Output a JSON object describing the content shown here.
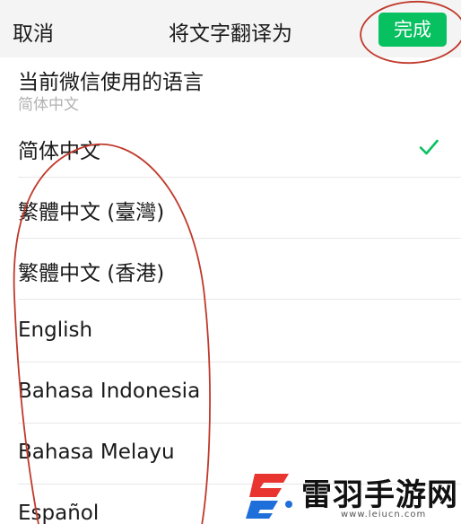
{
  "nav": {
    "cancel_label": "取消",
    "title": "将文字翻译为",
    "done_label": "完成"
  },
  "current_language": {
    "label": "当前微信使用的语言",
    "value": "简体中文"
  },
  "languages": [
    {
      "label": "简体中文",
      "selected": true
    },
    {
      "label": "繁體中文 (臺灣)",
      "selected": false
    },
    {
      "label": "繁體中文 (香港)",
      "selected": false
    },
    {
      "label": "English",
      "selected": false
    },
    {
      "label": "Bahasa Indonesia",
      "selected": false
    },
    {
      "label": "Bahasa Melayu",
      "selected": false
    },
    {
      "label": "Español",
      "selected": false
    }
  ],
  "icons": {
    "selected": "check-icon"
  },
  "colors": {
    "accent": "#07c160",
    "annotation": "#c0392b",
    "watermark_red": "#e8352f",
    "watermark_blue": "#1e6fd9"
  },
  "watermark": {
    "brand": "雷羽手游网",
    "url": "www.leiucn.com"
  }
}
